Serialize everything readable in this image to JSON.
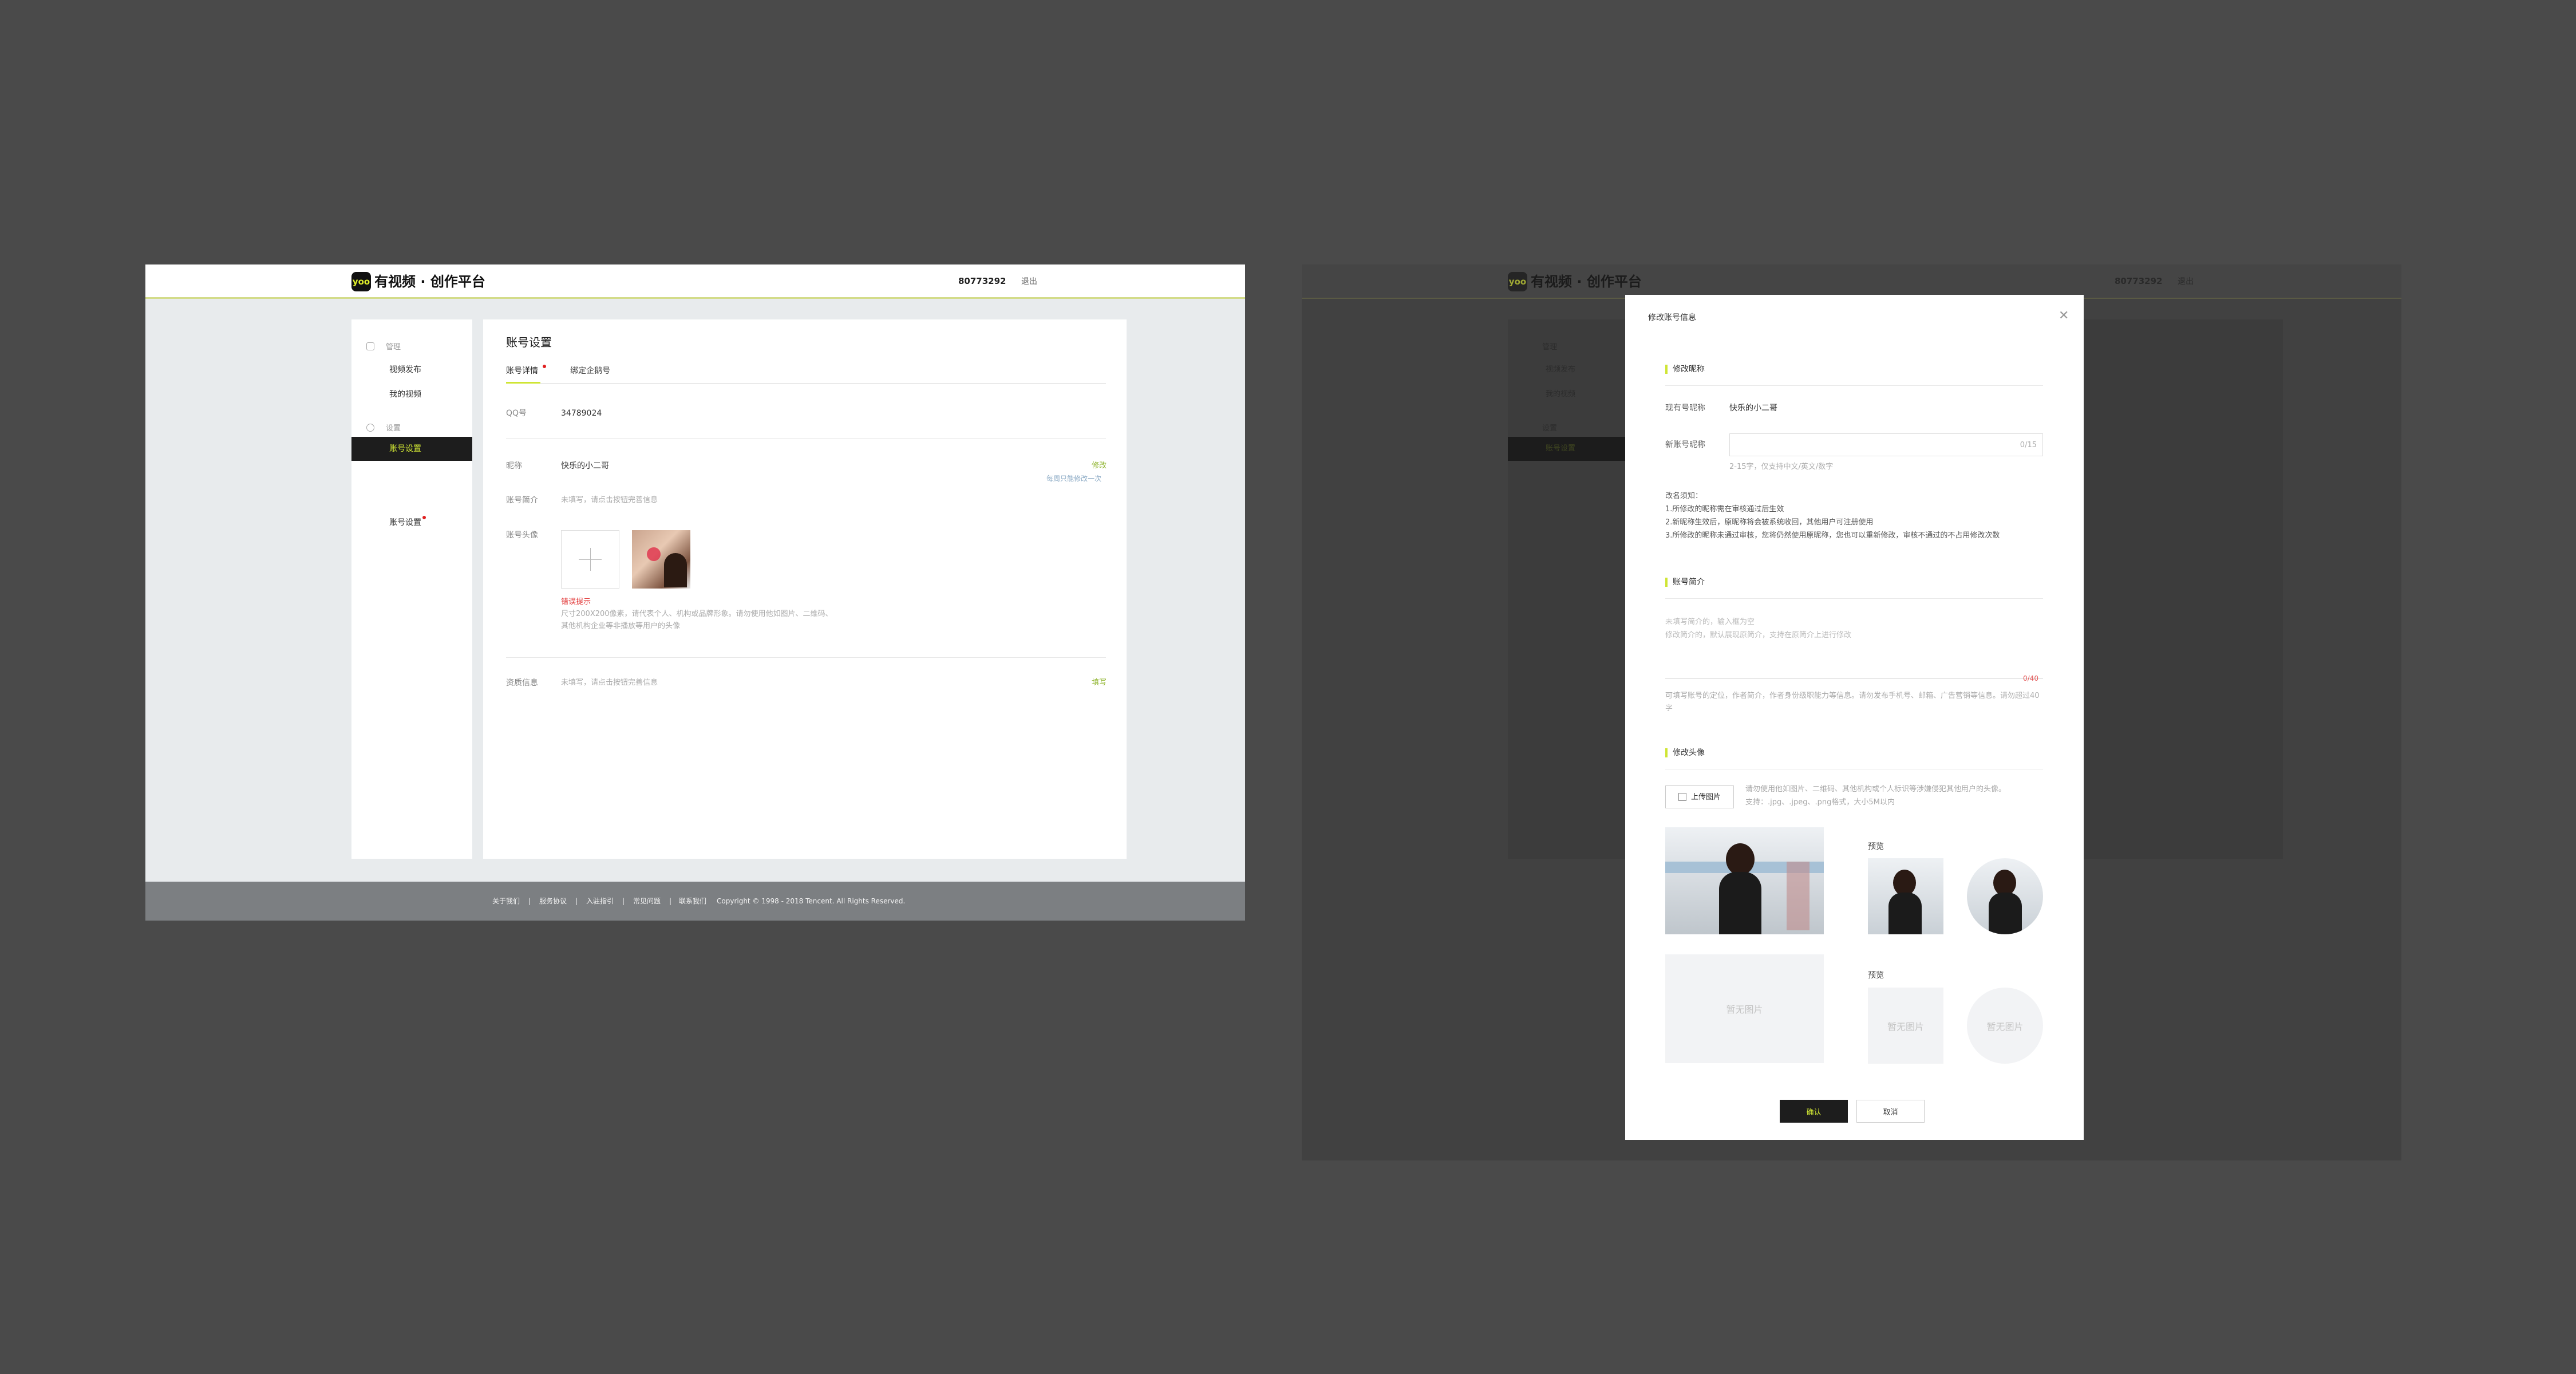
{
  "left": {
    "header": {
      "brand": "有视频 · 创作平台",
      "logo_badge": "yoo",
      "account_id": "80773292",
      "logout": "退出"
    },
    "sidebar": {
      "manage_label": "管理",
      "items_manage": [
        "视频发布",
        "我的视频"
      ],
      "settings_label": "设置",
      "active_item": "账号设置",
      "extra_item": "账号设置"
    },
    "main": {
      "title": "账号设置",
      "tabs": [
        "账号详情",
        "绑定企鹅号"
      ],
      "qq_label": "QQ号",
      "qq_value": "34789024",
      "nickname_label": "昵称",
      "nickname_value": "快乐的小二哥",
      "nickname_edit": "修改",
      "nickname_limit": "每周只能修改一次",
      "intro_label": "账号简介",
      "intro_placeholder": "未填写，请点击按钮完善信息",
      "avatar_label": "账号头像",
      "avatar_error": "错误提示",
      "avatar_hint1": "尺寸200X200像素，请代表个人、机构或品牌形象。请勿使用他如图片、二维码、",
      "avatar_hint2": "其他机构企业等非播放等用户的头像",
      "more_label": "资质信息",
      "more_placeholder": "未填写，请点击按钮完善信息",
      "more_edit": "填写"
    },
    "footer": {
      "links": [
        "关于我们",
        "服务协议",
        "入驻指引",
        "常见问题",
        "联系我们"
      ],
      "copyright": "Copyright © 1998 - 2018 Tencent. All Rights Reserved."
    }
  },
  "right": {
    "bg": {
      "brand": "有视频 · 创作平台",
      "account_id": "80773292",
      "logout": "退出",
      "side_items": [
        "管理",
        "视频发布",
        "我的视频",
        "设置",
        "账号设置"
      ]
    },
    "modal": {
      "title": "修改账号信息",
      "close_icon": "close-icon",
      "sec_nickname": "修改昵称",
      "current_label": "现有号昵称",
      "current_value": "快乐的小二哥",
      "new_label": "新账号昵称",
      "new_counter": "0/15",
      "new_hint": "2-15字，仅支持中文/英文/数字",
      "rules_title": "改名须知：",
      "rules": [
        "1.所修改的昵称需在审核通过后生效",
        "2.新昵称生效后，原昵称将会被系统收回，其他用户可注册使用",
        "3.所修改的昵称未通过审核，您将仍然使用原昵称，您也可以重新修改，审核不通过的不占用修改次数"
      ],
      "sec_intro": "账号简介",
      "intro_placeholder1": "未填写简介的，输入框为空",
      "intro_placeholder2": "修改简介的，默认展现原简介，支持在原简介上进行修改",
      "intro_counter": "0/40",
      "intro_help": "可填写账号的定位，作者简介，作者身份级职能力等信息。请勿发布手机号、邮箱、广告营销等信息。请勿超过40字",
      "sec_avatar": "修改头像",
      "upload_label": "上传图片",
      "upload_hint1": "请勿使用他如图片、二维码、其他机构或个人标识等涉嫌侵犯其他用户的头像。",
      "upload_hint2": "支持：.jpg、.jpeg、.png格式，大小5M以内",
      "preview_label": "预览",
      "no_image": "暂无图片",
      "confirm": "确认",
      "cancel": "取消"
    }
  },
  "colors": {
    "accent": "#cfe534",
    "green_text": "#8db32a",
    "dark": "#1d1d1d"
  }
}
